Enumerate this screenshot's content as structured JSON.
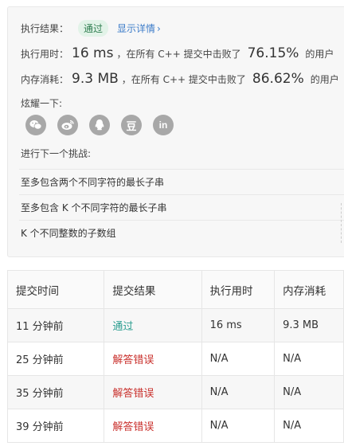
{
  "result": {
    "exec_result_label": "执行结果：",
    "status": "通过",
    "details_link": "显示详情",
    "details_chevron": "›",
    "runtime_label": "执行用时：",
    "runtime_value": "16 ms",
    "runtime_text": "，在所有 C++ 提交中击败了",
    "runtime_percent": "76.15%",
    "runtime_users": "的用户",
    "memory_label": "内存消耗：",
    "memory_value": "9.3 MB",
    "memory_text": "，在所有 C++ 提交中击败了",
    "memory_percent": "86.62%",
    "memory_users": "的用户",
    "share_label": "炫耀一下:",
    "share_icons": [
      "wechat-icon",
      "weibo-icon",
      "qq-icon",
      "douban-icon",
      "linkedin-icon"
    ],
    "douban_glyph": "豆",
    "linkedin_glyph": "in",
    "next_label": "进行下一个挑战:",
    "challenges": [
      "至多包含两个不同字符的最长子串",
      "至多包含 K 个不同字符的最长子串",
      "K 个不同整数的子数组"
    ]
  },
  "submissions": {
    "headers": [
      "提交时间",
      "提交结果",
      "执行用时",
      "内存消耗"
    ],
    "rows": [
      {
        "time": "11 分钟前",
        "result": "通过",
        "runtime": "16 ms",
        "memory": "9.3 MB"
      },
      {
        "time": "25 分钟前",
        "result": "解答错误",
        "runtime": "N/A",
        "memory": "N/A"
      },
      {
        "time": "35 分钟前",
        "result": "解答错误",
        "runtime": "N/A",
        "memory": "N/A"
      },
      {
        "time": "39 分钟前",
        "result": "解答错误",
        "runtime": "N/A",
        "memory": "N/A"
      }
    ]
  },
  "colors": {
    "accepted": "#2a9d8f",
    "wrong": "#c9302c",
    "link": "#3d7cc9",
    "badge_bg": "#e2f3e8"
  }
}
